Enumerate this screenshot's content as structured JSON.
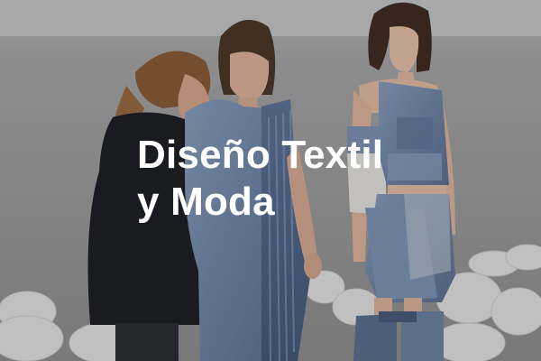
{
  "card": {
    "title_line1": "Diseño Textil",
    "title_line2": "y Moda"
  },
  "colors": {
    "title_text": "#ffffff",
    "denim": "#6f86a8",
    "background_wall": "#9b9b9b"
  }
}
